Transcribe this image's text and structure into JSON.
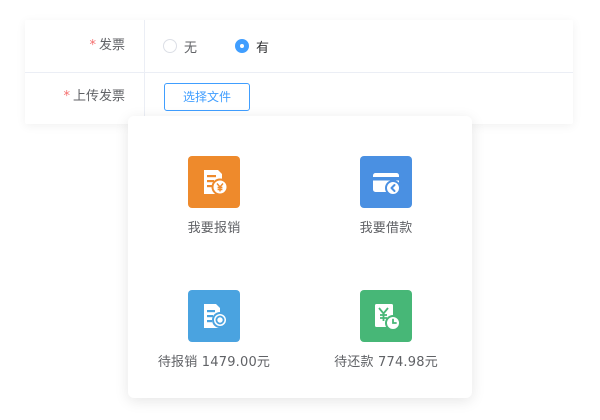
{
  "form": {
    "invoice_row": {
      "required_mark": "*",
      "label": "发票",
      "options": [
        {
          "label": "无",
          "checked": false
        },
        {
          "label": "有",
          "checked": true
        }
      ]
    },
    "upload_row": {
      "required_mark": "*",
      "label": "上传发票",
      "button_label": "选择文件"
    }
  },
  "menu": {
    "tiles": [
      {
        "label": "我要报销",
        "icon": "reimburse-doc-yen-icon",
        "color": "#ee8a2c"
      },
      {
        "label": "我要借款",
        "icon": "card-loan-icon",
        "color": "#4a90e2"
      },
      {
        "label": "待报销 1479.00元",
        "icon": "pending-doc-clock-icon",
        "color": "#4aa3e0"
      },
      {
        "label": "待还款 774.98元",
        "icon": "yen-clock-repay-icon",
        "color": "#47b777"
      }
    ]
  },
  "colors": {
    "accent": "#409eff",
    "required": "#f56c6c",
    "border": "#ebeef5"
  }
}
